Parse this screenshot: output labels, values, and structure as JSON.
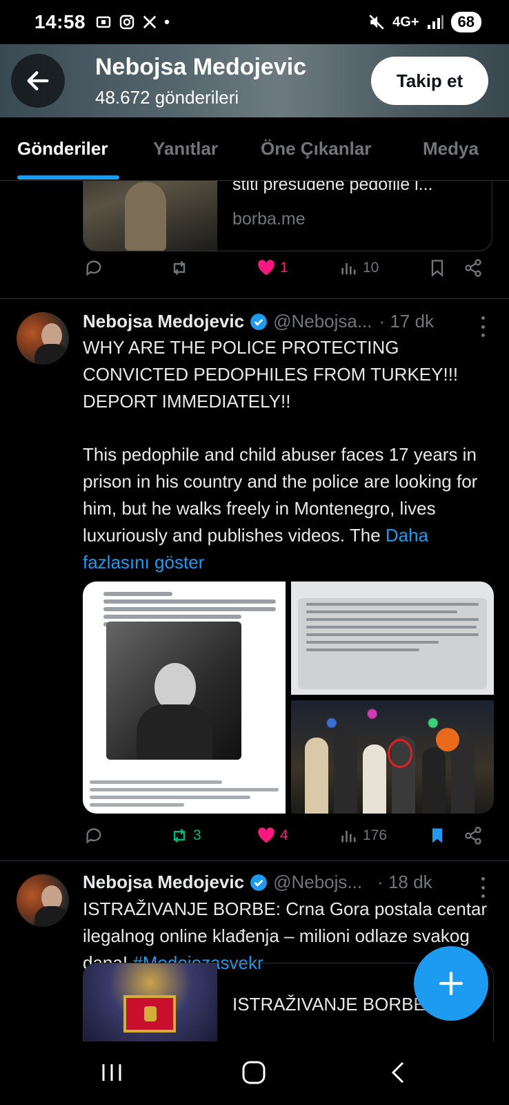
{
  "status_bar": {
    "time": "14:58",
    "network": "4G+",
    "battery": "68"
  },
  "header": {
    "name": "Nebojsa Medojevic",
    "posts_count": "48.672 gönderileri",
    "follow_label": "Takip et"
  },
  "tabs": [
    {
      "label": "Gönderiler",
      "active": true
    },
    {
      "label": "Yanıtlar",
      "active": false
    },
    {
      "label": "Öne Çıkanlar",
      "active": false
    },
    {
      "label": "Medya",
      "active": false
    }
  ],
  "prev_tweet": {
    "card_text": "stiti presudene pedofile i...",
    "card_source": "borba.me",
    "likes": "1",
    "views": "10"
  },
  "tweet1": {
    "name": "Nebojsa Medojevic",
    "handle": "@Nebojsa...",
    "time": "· 17 dk",
    "text": "WHY ARE THE POLICE PROTECTING CONVICTED PEDOPHILES FROM TURKEY!!! DEPORT IMMEDIATELY!!",
    "text2": "This pedophile and child abuser faces 17 years in prison in his country and the police are looking for him, but he walks freely in Montenegro, lives luxuriously and publishes videos. The",
    "show_more": "Daha fazlasını göster",
    "retweets": "3",
    "likes": "4",
    "views": "176"
  },
  "tweet2": {
    "name": "Nebojsa Medojevic",
    "handle": "@Nebojs...",
    "time": "· 18 dk",
    "text": "ISTRAŽIVANJE BORBE: Crna Gora postala centar ilegalnog online klađenja – milioni odlaze svakog dana!",
    "hashtag": "#Medojezasvekr",
    "card_text": "ISTRAŽIVANJE BORBE:"
  },
  "colors": {
    "accent": "#1d9bf0",
    "like": "#f91880",
    "retweet": "#00ba7c",
    "muted": "#71767b"
  }
}
